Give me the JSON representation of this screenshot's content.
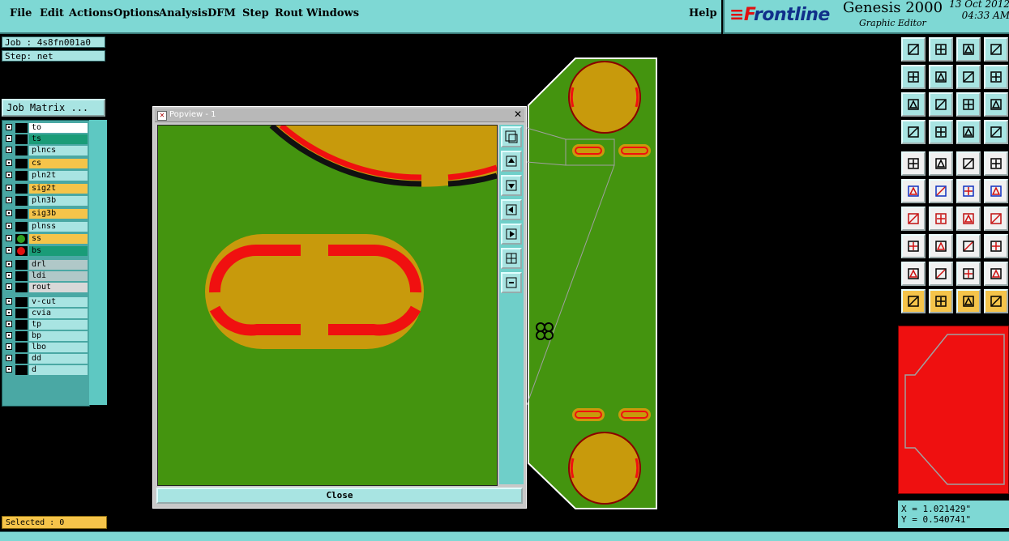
{
  "menu": {
    "items": [
      "File",
      "Edit",
      "Actions",
      "Options",
      "Analysis",
      "DFM",
      "Step",
      "Rout",
      "Windows"
    ],
    "help": "Help"
  },
  "brand": {
    "logo_red": "≡F",
    "logo_blue": "rontline",
    "product": "Genesis 2000",
    "subtitle": "Graphic Editor",
    "date": "13 Oct 2012",
    "time": "04:33 AM"
  },
  "job": {
    "job_label": "Job : 4s8fn001a0",
    "step_label": "Step: net",
    "matrix_button": "Job Matrix ..."
  },
  "layers": [
    {
      "name": "to",
      "bg": "#ffffff",
      "dot": ""
    },
    {
      "name": "ts",
      "bg": "#1a9c78",
      "dot": ""
    },
    {
      "name": "plncs",
      "bg": "#a8e4e2",
      "dot": ""
    },
    {
      "name": "cs",
      "bg": "#f5c44a",
      "dot": ""
    },
    {
      "name": "pln2t",
      "bg": "#a8e4e2",
      "dot": ""
    },
    {
      "name": "sig2t",
      "bg": "#f5c44a",
      "dot": ""
    },
    {
      "name": "pln3b",
      "bg": "#a8e4e2",
      "dot": ""
    },
    {
      "name": "sig3b",
      "bg": "#f5c44a",
      "dot": ""
    },
    {
      "name": "plnss",
      "bg": "#a8e4e2",
      "dot": ""
    },
    {
      "name": "ss",
      "bg": "#f5c44a",
      "dot": "#30a020"
    },
    {
      "name": "bs",
      "bg": "#1a9c78",
      "dot": "#e01010"
    },
    {
      "name": "drl",
      "bg": "#b0c8c8",
      "dot": ""
    },
    {
      "name": "ldi",
      "bg": "#b0c8c8",
      "dot": ""
    },
    {
      "name": "rout",
      "bg": "#d8d8d8",
      "dot": ""
    },
    {
      "name": "v-cut",
      "bg": "#a8e4e2",
      "dot": ""
    },
    {
      "name": "cvia",
      "bg": "#a8e4e2",
      "dot": ""
    },
    {
      "name": "tp",
      "bg": "#a8e4e2",
      "dot": ""
    },
    {
      "name": "bp",
      "bg": "#a8e4e2",
      "dot": ""
    },
    {
      "name": "lbo",
      "bg": "#a8e4e2",
      "dot": ""
    },
    {
      "name": "dd",
      "bg": "#a8e4e2",
      "dot": ""
    },
    {
      "name": "d",
      "bg": "#a8e4e2",
      "dot": ""
    }
  ],
  "selected_label": "Selected : 0",
  "popview": {
    "title": "Popview - 1",
    "close_label": "Close"
  },
  "coords": {
    "x": "X = 1.021429\"",
    "y": "Y = 0.540741\""
  },
  "colors": {
    "board_green": "#44940f",
    "pad_gold": "#c89a0c",
    "trace_red": "#f01010",
    "panel_cyan": "#7ed8d4"
  }
}
